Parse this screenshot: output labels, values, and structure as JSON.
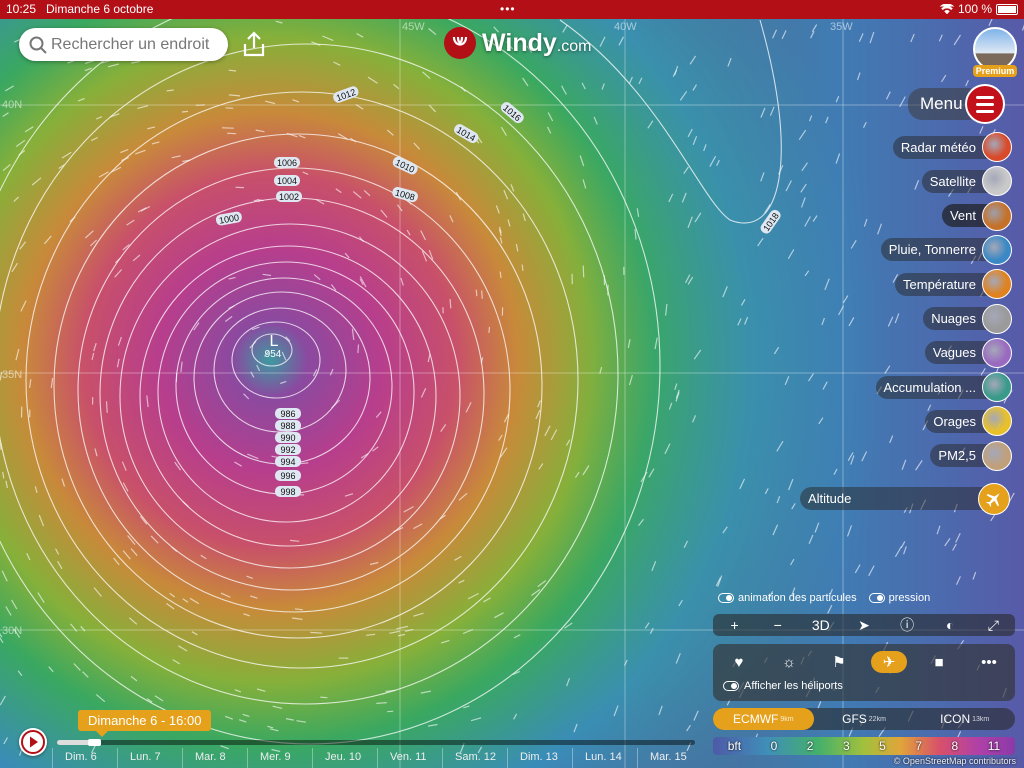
{
  "status": {
    "time": "10:25",
    "date": "Dimanche 6 octobre",
    "dots": "•••",
    "battery": "100 %"
  },
  "search": {
    "placeholder": "Rechercher un endroit"
  },
  "brand": {
    "name": "Windy",
    "suffix": ".com"
  },
  "premium": {
    "label": "Premium"
  },
  "menu": {
    "label": "Menu"
  },
  "layers": [
    {
      "label": "Radar météo",
      "icon": "radar-icon",
      "color": "#d84a2a"
    },
    {
      "label": "Satellite",
      "icon": "satellite-icon",
      "color": "#c9c9c9"
    },
    {
      "label": "Vent",
      "icon": "wind-icon",
      "color": "#c5712a",
      "active": true
    },
    {
      "label": "Pluie, Tonnerre",
      "icon": "rain-icon",
      "color": "#3a88c4"
    },
    {
      "label": "Température",
      "icon": "temperature-icon",
      "color": "#e0821e"
    },
    {
      "label": "Nuages",
      "icon": "clouds-icon",
      "color": "#9a9a9a"
    },
    {
      "label": "Vagues",
      "icon": "waves-icon",
      "color": "#9a6ac0"
    },
    {
      "label": "Accumulation ...",
      "icon": "accumulation-icon",
      "color": "#3a9a8a"
    },
    {
      "label": "Orages",
      "icon": "thunderstorm-icon",
      "color": "#e8c02a"
    },
    {
      "label": "PM2,5",
      "icon": "pm25-icon",
      "color": "#c0a07a"
    }
  ],
  "altitude": {
    "label": "Altitude"
  },
  "map": {
    "low_label": "L",
    "low_value": "954",
    "pressure_labels": [
      "1012",
      "1016",
      "1014",
      "1010",
      "1006",
      "1004",
      "1002",
      "1008",
      "1000",
      "1018",
      "986",
      "988",
      "990",
      "992",
      "994",
      "996",
      "998"
    ],
    "lat_labels": [
      "40N",
      "35N",
      "30N"
    ],
    "lon_labels": [
      "45W",
      "40W",
      "35W"
    ]
  },
  "toggles": {
    "particles": "animation des particules",
    "pressure": "pression"
  },
  "controls": [
    "+",
    "−",
    "3D",
    "➤",
    "ⓘ",
    "◐",
    "⤢"
  ],
  "panel": {
    "items": [
      "♥",
      "☼",
      "⚑",
      "✈",
      "■",
      "•••"
    ],
    "heliports": "Afficher les héliports"
  },
  "models": [
    {
      "name": "ECMWF",
      "res": "9km",
      "active": true
    },
    {
      "name": "GFS",
      "res": "22km"
    },
    {
      "name": "ICON",
      "res": "13km"
    }
  ],
  "scale": {
    "unit": "bft",
    "values": [
      "0",
      "2",
      "3",
      "5",
      "7",
      "8",
      "11"
    ]
  },
  "attribution": "© OpenStreetMap contributors",
  "timeline": {
    "current": "Dimanche 6 - 16:00",
    "days": [
      "Dim. 6",
      "Lun. 7",
      "Mar. 8",
      "Mer. 9",
      "Jeu. 10",
      "Ven. 11",
      "Sam. 12",
      "Dim. 13",
      "Lun. 14",
      "Mar. 15"
    ]
  }
}
